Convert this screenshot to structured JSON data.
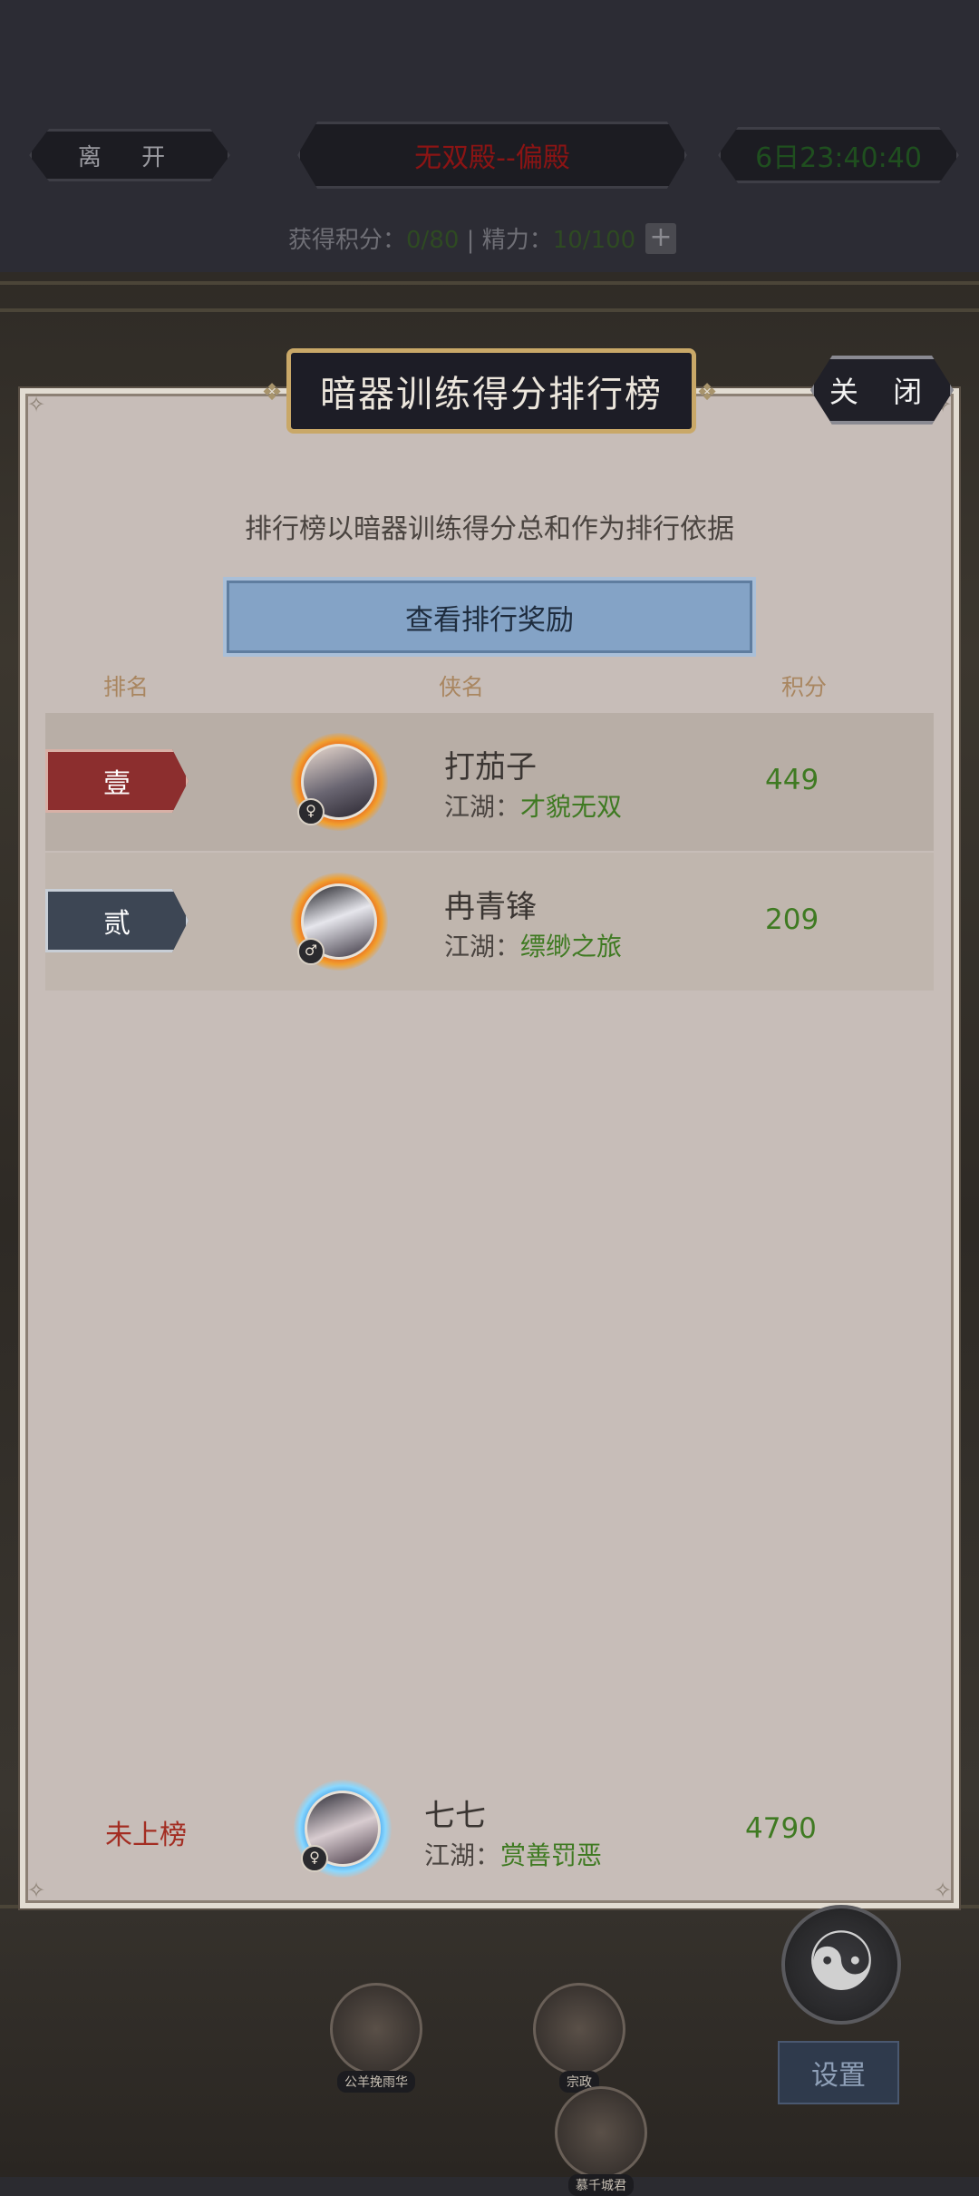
{
  "top_bar": {
    "leave_label": "离 开",
    "hall_name": "无双殿--偏殿",
    "countdown": "6日23:40:40",
    "points_label": "获得积分：",
    "points_value": "0/80",
    "divider": "|",
    "energy_label": "精力：",
    "energy_value": "10/100",
    "plus_label": "+"
  },
  "panel": {
    "title": "暗器训练得分排行榜",
    "close_label": "关 闭",
    "description": "排行榜以暗器训练得分总和作为排行依据",
    "reward_button_label": "查看排行奖励",
    "columns": {
      "rank": "排名",
      "name": "侠名",
      "score": "积分"
    },
    "rows": [
      {
        "rank": "壹",
        "name": "打茄子",
        "jianghu_label": "江湖：",
        "title": "才貌无双",
        "score": "449",
        "gender": "♀"
      },
      {
        "rank": "贰",
        "name": "冉青锋",
        "jianghu_label": "江湖：",
        "title": "缥缈之旅",
        "score": "209",
        "gender": "♂"
      }
    ],
    "self": {
      "rank": "未上榜",
      "name": "七七",
      "jianghu_label": "江湖：",
      "title": "赏善罚恶",
      "score": "4790",
      "gender": "♀"
    }
  },
  "scene": {
    "settings_label": "设置",
    "npcs": [
      "公羊挽雨华",
      "宗政",
      "慕千城君"
    ]
  },
  "colors": {
    "accent_green": "#3f7a22",
    "rank_red": "#8c2e2e",
    "rank_gray": "#3d4654",
    "button_blue": "#84a3c6"
  }
}
